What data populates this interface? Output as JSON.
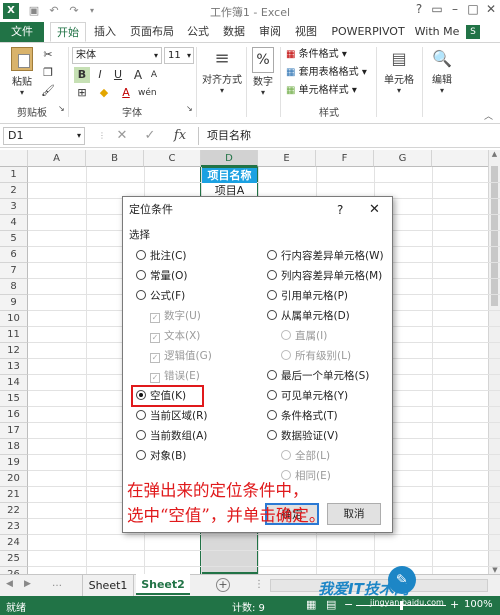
{
  "window": {
    "title": "工作簿1 - Excel",
    "help": "?"
  },
  "ribbon_tabs": [
    "文件",
    "开始",
    "插入",
    "页面布局",
    "公式",
    "数据",
    "审阅",
    "视图",
    "POWERPIVOT",
    "With Me"
  ],
  "account_initial": "S",
  "ribbon": {
    "paste_label": "粘贴",
    "font_name": "宋体",
    "font_size": "11",
    "bold": "B",
    "italic": "I",
    "underline": "U",
    "grow_font": "A",
    "shrink_font": "A",
    "font_color_letter": "A",
    "align_label": "对齐方式",
    "number_label": "数字",
    "percent": "%",
    "cond_format": "条件格式",
    "table_format": "套用表格格式",
    "cell_style": "单元格样式",
    "cells_label": "单元格",
    "edit_label": "编辑",
    "groups": {
      "clipboard": "剪贴板",
      "font": "字体",
      "styles": "样式"
    }
  },
  "formula_bar": {
    "name_box": "D1",
    "fx": "fx",
    "content": "项目名称"
  },
  "grid": {
    "columns": [
      "A",
      "B",
      "C",
      "D",
      "E",
      "F",
      "G"
    ],
    "rows": [
      "1",
      "2",
      "3",
      "4",
      "5",
      "6",
      "7",
      "8",
      "9",
      "10",
      "11",
      "12",
      "13",
      "14",
      "15",
      "16",
      "17",
      "18",
      "19",
      "20",
      "21",
      "22",
      "23",
      "24",
      "25",
      "26",
      "27",
      "28"
    ],
    "d1": "项目名称",
    "d2": "项目A"
  },
  "dialog": {
    "title": "定位条件",
    "help": "?",
    "close": "✕",
    "section": "选择",
    "left_options": [
      {
        "label": "批注(C)",
        "selected": false
      },
      {
        "label": "常量(O)",
        "selected": false
      },
      {
        "label": "公式(F)",
        "selected": false
      }
    ],
    "formula_subs": [
      "数字(U)",
      "文本(X)",
      "逻辑值(G)",
      "错误(E)"
    ],
    "left_options_2": [
      {
        "label": "空值(K)",
        "selected": true
      },
      {
        "label": "当前区域(R)",
        "selected": false
      },
      {
        "label": "当前数组(A)",
        "selected": false
      },
      {
        "label": "对象(B)",
        "selected": false
      }
    ],
    "right_options": [
      {
        "label": "行内容差异单元格(W)",
        "selected": false
      },
      {
        "label": "列内容差异单元格(M)",
        "selected": false
      },
      {
        "label": "引用单元格(P)",
        "selected": false
      },
      {
        "label": "从属单元格(D)",
        "selected": false
      }
    ],
    "dependents_subs": [
      "直属(I)",
      "所有级别(L)"
    ],
    "right_options_2": [
      {
        "label": "最后一个单元格(S)",
        "selected": false
      },
      {
        "label": "可见单元格(Y)",
        "selected": false
      },
      {
        "label": "条件格式(T)",
        "selected": false
      },
      {
        "label": "数据验证(V)",
        "selected": false
      }
    ],
    "validation_subs": [
      "全部(L)",
      "相同(E)"
    ],
    "ok": "确定",
    "cancel": "取消"
  },
  "annotation": {
    "line1": "在弹出来的定位条件中，",
    "line2": "选中“空值”，并单击确定。"
  },
  "sheets": {
    "tabs": [
      "Sheet1",
      "Sheet2"
    ],
    "active": "Sheet2",
    "add": "+"
  },
  "status": {
    "ready": "就绪",
    "count": "计数: 9",
    "zoom": "100%"
  },
  "watermark": {
    "text": "我爱IT技术网",
    "url": "jingyan.baidu.com"
  },
  "colors": {
    "excel_green": "#217346",
    "dialog_header": "#1ba1e2",
    "annotation_red": "#e0191b",
    "selected_column": "#d9d9d9"
  }
}
